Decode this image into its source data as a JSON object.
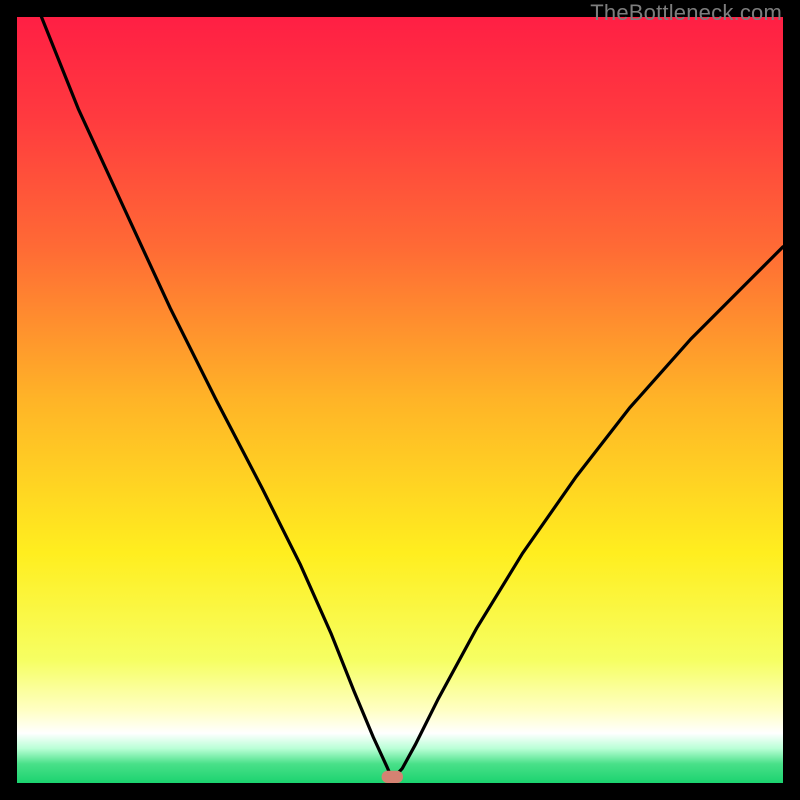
{
  "watermark": "TheBottleneck.com",
  "colors": {
    "frame_bg": "#000000",
    "curve": "#000000",
    "minimum_marker": "#d58272",
    "gradient_stops": [
      {
        "offset": 0.0,
        "color": "#ff1f44"
      },
      {
        "offset": 0.13,
        "color": "#ff3a3f"
      },
      {
        "offset": 0.3,
        "color": "#ff6a35"
      },
      {
        "offset": 0.5,
        "color": "#ffb427"
      },
      {
        "offset": 0.7,
        "color": "#ffee1f"
      },
      {
        "offset": 0.84,
        "color": "#f6ff63"
      },
      {
        "offset": 0.905,
        "color": "#ffffc4"
      },
      {
        "offset": 0.935,
        "color": "#ffffff"
      },
      {
        "offset": 0.955,
        "color": "#b9ffd6"
      },
      {
        "offset": 0.975,
        "color": "#49e089"
      },
      {
        "offset": 1.0,
        "color": "#1bd36f"
      }
    ]
  },
  "chart_data": {
    "type": "line",
    "title": "",
    "xlabel": "",
    "ylabel": "",
    "xlim": [
      0,
      100
    ],
    "ylim": [
      0,
      100
    ],
    "minimum_marker": {
      "x": 49,
      "y": 0,
      "w": 2.8,
      "h": 1.6
    },
    "series": [
      {
        "name": "bottleneck-curve",
        "x": [
          3.2,
          8,
          14,
          20,
          26,
          32,
          37,
          41,
          44,
          46.5,
          48.3,
          49,
          50.3,
          52,
          55,
          60,
          66,
          73,
          80,
          88,
          96,
          100
        ],
        "values": [
          100,
          88,
          75,
          62,
          50,
          38.5,
          28.5,
          19.5,
          12,
          6,
          2.1,
          0.5,
          1.9,
          5,
          11,
          20.2,
          30,
          40,
          49,
          58,
          66,
          70
        ]
      }
    ]
  }
}
